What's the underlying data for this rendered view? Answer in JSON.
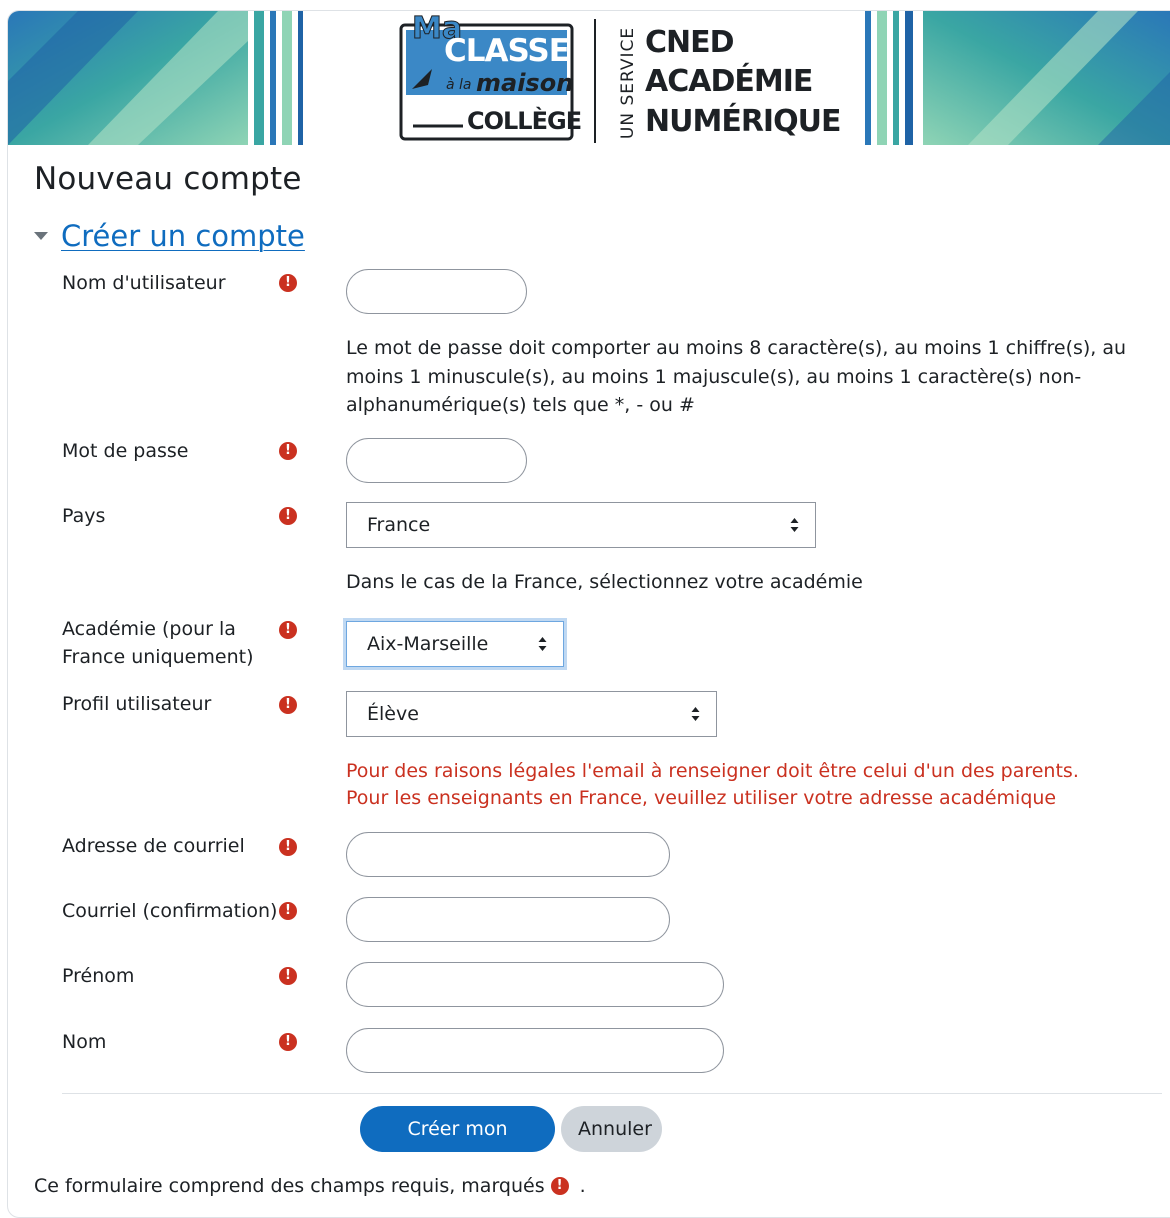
{
  "banner": {
    "logo_ma": "Ma",
    "logo_classe": "CLASSE",
    "logo_a_la": "à la",
    "logo_maison": "maison",
    "logo_college": "COLLÈGE",
    "service_label": "UN SERVICE",
    "cned_line1": "CNED",
    "cned_line2": "ACADÉMIE",
    "cned_line3": "NUMÉRIQUE"
  },
  "page_title": "Nouveau compte",
  "section_title": "Créer un compte",
  "fields": {
    "username_label": "Nom d'utilisateur",
    "password_rules": "Le mot de passe doit comporter au moins 8 caractère(s), au moins 1 chiffre(s), au moins 1 minuscule(s), au moins 1 majuscule(s), au moins 1 caractère(s) non-alphanumérique(s) tels que *, - ou #",
    "password_label": "Mot de passe",
    "country_label": "Pays",
    "country_value": "France",
    "academy_hint": "Dans le cas de la France, sélectionnez votre académie",
    "academy_label_line1": "Académie (pour la",
    "academy_label_line2": "France uniquement)",
    "academy_value": "Aix-Marseille",
    "profile_label": "Profil utilisateur",
    "profile_value": "Élève",
    "email_warning_line1": "Pour des raisons légales l'email à renseigner doit être celui d'un des parents.",
    "email_warning_line2": "Pour les enseignants en France, veuillez utiliser votre adresse académique",
    "email_label": "Adresse de courriel",
    "email_confirm_label": "Courriel (confirmation)",
    "firstname_label": "Prénom",
    "lastname_label": "Nom",
    "required_glyph": "!"
  },
  "buttons": {
    "submit": "Créer mon compte",
    "cancel": "Annuler"
  },
  "footnote": {
    "text": "Ce formulaire comprend des champs requis, marqués",
    "end": "."
  },
  "colors": {
    "link": "#0f6cbf",
    "required": "#ca3120",
    "primary_button": "#0f6cbf",
    "secondary_button": "#ced4da"
  }
}
